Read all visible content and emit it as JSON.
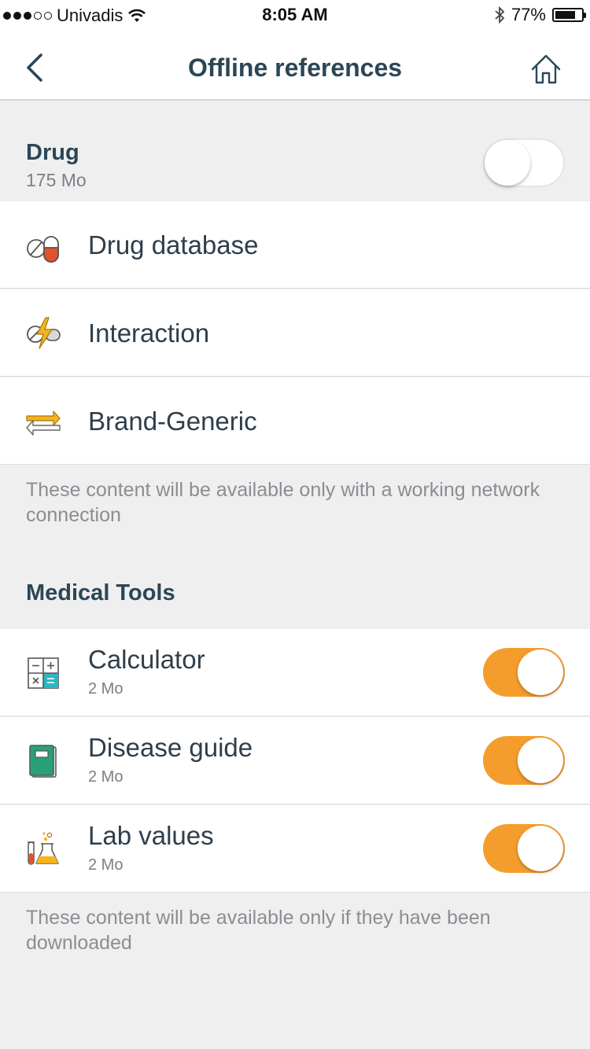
{
  "status_bar": {
    "carrier": "Univadis",
    "time": "8:05 AM",
    "battery_percent": "77%",
    "battery_level": 0.77,
    "signal_bars_filled": 3,
    "signal_bars_total": 5
  },
  "nav": {
    "title": "Offline references",
    "back_icon": "chevron-left-icon",
    "home_icon": "home-icon"
  },
  "drug_section": {
    "title": "Drug",
    "size": "175 Mo",
    "toggle_on": false,
    "items": [
      {
        "label": "Drug database",
        "icon": "pill-icon"
      },
      {
        "label": "Interaction",
        "icon": "interaction-icon"
      },
      {
        "label": "Brand-Generic",
        "icon": "swap-arrows-icon"
      }
    ],
    "note": "These content will be available only with a working network connection"
  },
  "medical_tools_section": {
    "title": "Medical Tools",
    "items": [
      {
        "label": "Calculator",
        "size": "2 Mo",
        "icon": "calculator-icon",
        "toggle_on": true
      },
      {
        "label": "Disease guide",
        "size": "2 Mo",
        "icon": "book-icon",
        "toggle_on": true
      },
      {
        "label": "Lab values",
        "size": "2 Mo",
        "icon": "lab-flask-icon",
        "toggle_on": true
      }
    ],
    "note": "These content will be available only if they have been downloaded"
  },
  "colors": {
    "accent_orange": "#f59d2c",
    "title_navy": "#2c4656",
    "background_gray": "#efeff0"
  }
}
